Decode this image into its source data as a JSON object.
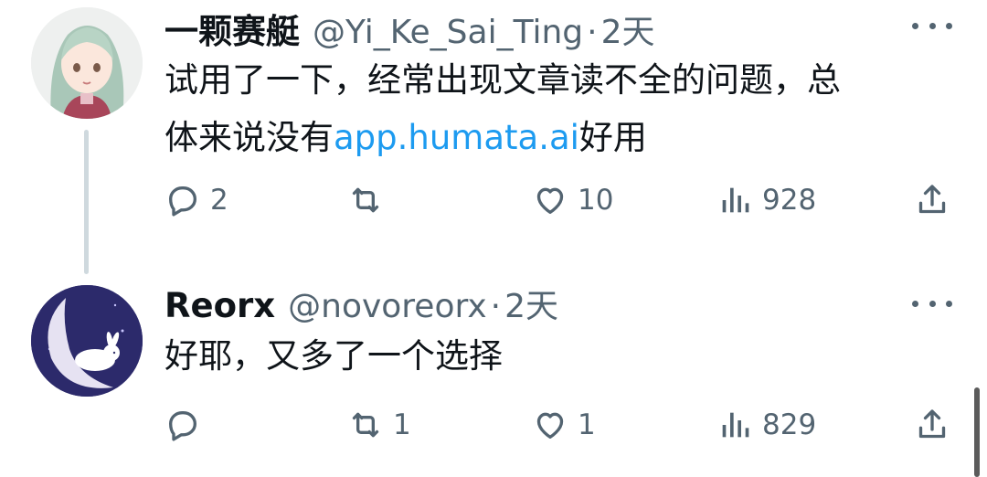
{
  "tweets": [
    {
      "display_name": "一颗赛艇",
      "handle": "@Yi_Ke_Sai_Ting",
      "separator": "·",
      "time": "2天",
      "text_line1": "试用了一下，经常出现文章读不全的问题，总",
      "text_line2_before": "体来说没有",
      "text_link": "app.humata.ai",
      "text_line2_after": "好用",
      "replies": "2",
      "retweets": "",
      "likes": "10",
      "views": "928",
      "avatar_icon": "anime-girl-avatar"
    },
    {
      "display_name": "Reorx",
      "handle": "@novoreorx",
      "separator": "·",
      "time": "2天",
      "text": "好耶，又多了一个选择",
      "replies": "",
      "retweets": "1",
      "likes": "1",
      "views": "829",
      "avatar_icon": "moon-rabbit-avatar"
    }
  ],
  "colors": {
    "text_primary": "#0f1419",
    "text_secondary": "#536471",
    "link": "#1d9bf0",
    "thread_line": "#cfd9de"
  }
}
